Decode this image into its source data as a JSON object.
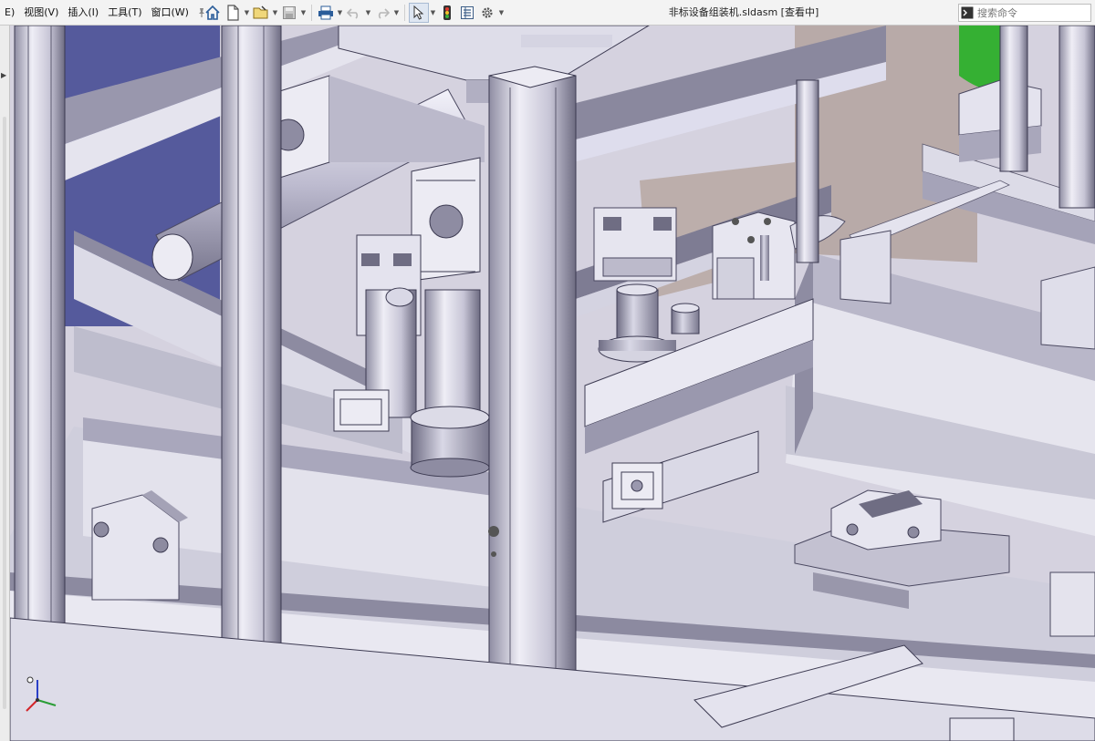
{
  "menu": {
    "items": [
      {
        "label": "E)"
      },
      {
        "label": "视图(V)"
      },
      {
        "label": "插入(I)"
      },
      {
        "label": "工具(T)"
      },
      {
        "label": "窗口(W)"
      }
    ]
  },
  "window": {
    "title": "非标设备组装机.sldasm [查看中]"
  },
  "search": {
    "placeholder": "搜索命令"
  },
  "icons": [
    "home-icon",
    "new-document-icon",
    "open-folder-icon",
    "save-icon",
    "print-icon",
    "undo-icon",
    "redo-icon",
    "select-arrow-icon",
    "traffic-light-icon",
    "file-properties-icon",
    "options-gear-icon",
    "pin-icon",
    "command-prompt-icon"
  ],
  "colors": {
    "toolbar_bg": "#f3f3f3",
    "metal_light": "#ecebf3",
    "metal_mid": "#b9b7c9",
    "metal_dark": "#5c5a6e",
    "back_wall": "#b6a7a4",
    "left_panel": "#555a9c",
    "accent_green": "#35b033"
  }
}
